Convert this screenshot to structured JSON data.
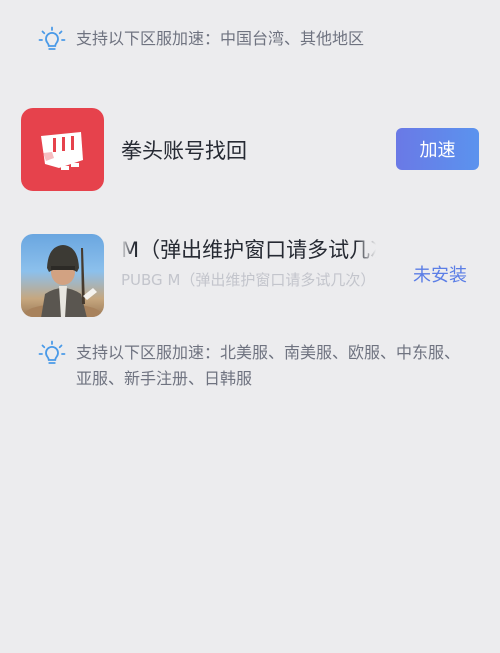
{
  "tips": [
    {
      "text": "支持以下区服加速：中国台湾、其他地区",
      "icon": "lightbulb-icon"
    },
    {
      "text": "支持以下区服加速：北美服、南美服、欧服、中东服、亚服、新手注册、日韩服",
      "icon": "lightbulb-icon"
    }
  ],
  "apps": [
    {
      "title": "拳头账号找回",
      "action_label": "加速",
      "icon": "riot-fist-icon"
    },
    {
      "title": "M（弹出维护窗口请多试几次）",
      "subtitle": "PUBG M（弹出维护窗口请多试几次）",
      "status_label": "未安装",
      "icon": "pubg-soldier-icon"
    }
  ],
  "colors": {
    "background": "#ececee",
    "accent": "#5b7ee6",
    "riot_red": "#e6424c",
    "tip_icon": "#4a9ae8"
  }
}
